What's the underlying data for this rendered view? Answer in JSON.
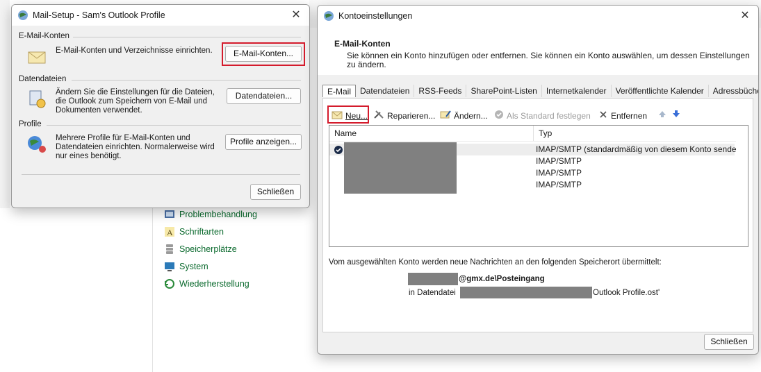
{
  "background": {
    "items": [
      {
        "label": "Problembehandlung",
        "icon": "troubleshoot-icon"
      },
      {
        "label": "Schriftarten",
        "icon": "fonts-icon"
      },
      {
        "label": "Speicherplätze",
        "icon": "storage-icon"
      },
      {
        "label": "System",
        "icon": "system-icon"
      },
      {
        "label": "Wiederherstellung",
        "icon": "recovery-icon"
      }
    ]
  },
  "mail_setup": {
    "title": "Mail-Setup - Sam's Outlook Profile",
    "sections": [
      {
        "group": "E-Mail-Konten",
        "text": "E-Mail-Konten und Verzeichnisse einrichten.",
        "button": "E-Mail-Konten...",
        "icon": "mail-accounts-icon"
      },
      {
        "group": "Datendateien",
        "text": "Ändern Sie die Einstellungen für die Dateien, die Outlook zum Speichern von E-Mail und Dokumenten verwendet.",
        "button": "Datendateien...",
        "icon": "data-files-icon"
      },
      {
        "group": "Profile",
        "text": "Mehrere Profile für E-Mail-Konten und Datendateien einrichten. Normalerweise wird nur eines benötigt.",
        "button": "Profile anzeigen...",
        "icon": "profiles-icon"
      }
    ],
    "close_label": "Schließen"
  },
  "konto": {
    "title": "Kontoeinstellungen",
    "header_title": "E-Mail-Konten",
    "header_desc": "Sie können ein Konto hinzufügen oder entfernen. Sie können ein Konto auswählen, um dessen Einstellungen zu ändern.",
    "tabs": [
      "E-Mail",
      "Datendateien",
      "RSS-Feeds",
      "SharePoint-Listen",
      "Internetkalender",
      "Veröffentlichte Kalender",
      "Adressbücher"
    ],
    "toolbar": {
      "new": "Neu...",
      "repair": "Reparieren...",
      "change": "Ändern...",
      "set_default": "Als Standard festlegen",
      "remove": "Entfernen"
    },
    "columns": {
      "name": "Name",
      "type": "Typ"
    },
    "rows": [
      {
        "type": "IMAP/SMTP (standardmäßig von diesem Konto senden)"
      },
      {
        "type": "IMAP/SMTP"
      },
      {
        "type": "IMAP/SMTP"
      },
      {
        "type": "IMAP/SMTP"
      }
    ],
    "delivery_text": "Vom ausgewählten Konto werden neue Nachrichten an den folgenden Speicherort übermittelt:",
    "delivery_folder": "@gmx.de\\Posteingang",
    "datafile_prefix": "in Datendatei",
    "datafile_suffix": "Outlook Profile.ost'",
    "close_label": "Schließen"
  }
}
